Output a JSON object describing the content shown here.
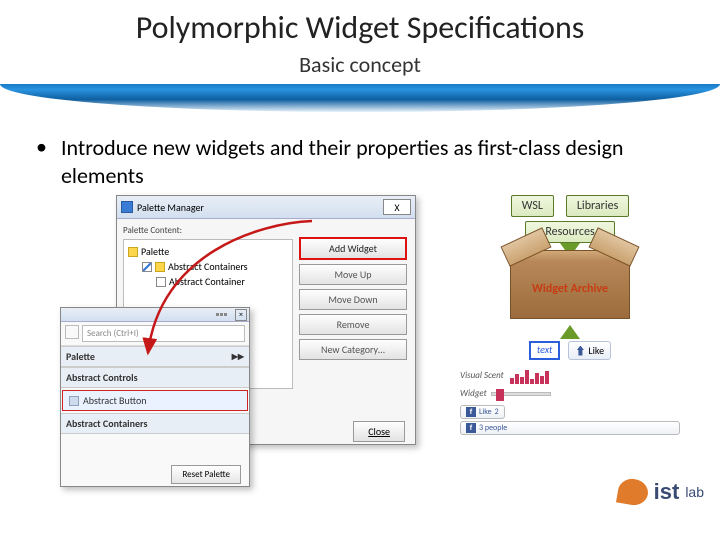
{
  "title": "Polymorphic Widget Specifications",
  "subtitle": "Basic concept",
  "bullet": "Introduce new widgets and their properties as first-class  design elements",
  "dlg1": {
    "title": "Palette Manager",
    "content_label": "Palette Content:",
    "tree": {
      "root": "Palette",
      "group": "Abstract Containers",
      "item": "Abstract Container"
    },
    "buttons": {
      "add": "Add Widget",
      "moveup": "Move Up",
      "movedown": "Move Down",
      "remove": "Remove",
      "newcat": "New Category…"
    },
    "close": "Close"
  },
  "dlg2": {
    "search_placeholder": "Search (Ctrl+I)",
    "section_palette": "Palette",
    "section_controls": "Abstract Controls",
    "item_button": "Abstract Button",
    "section_containers": "Abstract Containers",
    "reset": "Reset Palette"
  },
  "archive": {
    "wsl": "WSL",
    "libraries": "Libraries",
    "resources": "Resources",
    "box_label": "Widget Archive",
    "widget_text": "text",
    "like": "Like",
    "vscent_label": "Visual Scent",
    "slider_label": "Widget",
    "fb_like_count": "2",
    "fb_like": "Like",
    "fb_people": "3 people"
  },
  "logo": {
    "ist": "ist",
    "lab": "lab"
  }
}
